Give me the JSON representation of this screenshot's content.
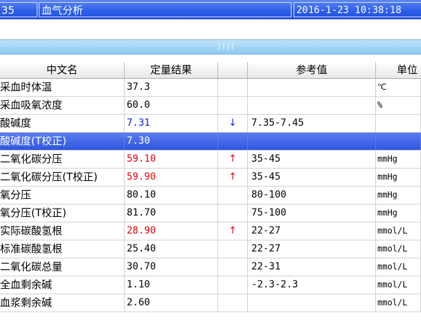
{
  "titlebar": {
    "record_number": "35",
    "title": "血气分析",
    "datetime": "2016-1-23 10:38:18"
  },
  "splitter": {
    "grip": "||||"
  },
  "table": {
    "headers": [
      "中文名",
      "定量结果",
      "",
      "参考值",
      "单位"
    ],
    "rows": [
      {
        "name": "采血时体温",
        "value": "37.3",
        "flag": "",
        "ref": "",
        "unit": "℃",
        "status": "normal"
      },
      {
        "name": "采血吸氧浓度",
        "value": "60.0",
        "flag": "",
        "ref": "",
        "unit": "%",
        "status": "normal"
      },
      {
        "name": "酸碱度",
        "value": "7.31",
        "flag": "↓",
        "ref": "7.35-7.45",
        "unit": "",
        "status": "low"
      },
      {
        "name": "酸碱度(T校正)",
        "value": "7.30",
        "flag": "",
        "ref": "",
        "unit": "",
        "status": "selected"
      },
      {
        "name": "二氧化碳分压",
        "value": "59.10",
        "flag": "↑",
        "ref": "35-45",
        "unit": "mmHg",
        "status": "high"
      },
      {
        "name": "二氧化碳分压(T校正)",
        "value": "59.90",
        "flag": "↑",
        "ref": "35-45",
        "unit": "mmHg",
        "status": "high"
      },
      {
        "name": "氧分压",
        "value": "80.10",
        "flag": "",
        "ref": "80-100",
        "unit": "mmHg",
        "status": "normal"
      },
      {
        "name": "氧分压(T校正)",
        "value": "81.70",
        "flag": "",
        "ref": "75-100",
        "unit": "mmHg",
        "status": "normal"
      },
      {
        "name": "实际碳酸氢根",
        "value": "28.90",
        "flag": "↑",
        "ref": "22-27",
        "unit": "mmol/L",
        "status": "high"
      },
      {
        "name": "标准碳酸氢根",
        "value": "25.40",
        "flag": "",
        "ref": "22-27",
        "unit": "mmol/L",
        "status": "normal"
      },
      {
        "name": "二氧化碳总量",
        "value": "30.70",
        "flag": "",
        "ref": "22-31",
        "unit": "mmol/L",
        "status": "normal"
      },
      {
        "name": "全血剩余碱",
        "value": "1.10",
        "flag": "",
        "ref": "-2.3-2.3",
        "unit": "mmol/L",
        "status": "normal"
      },
      {
        "name": "血浆剩余碱",
        "value": "2.60",
        "flag": "",
        "ref": "",
        "unit": "mmol/L",
        "status": "normal"
      }
    ]
  },
  "colors": {
    "titlebar": "#2b5de8",
    "selected_row": "#3a5fe3",
    "high": "#e8000b",
    "low": "#0b1fd6"
  }
}
